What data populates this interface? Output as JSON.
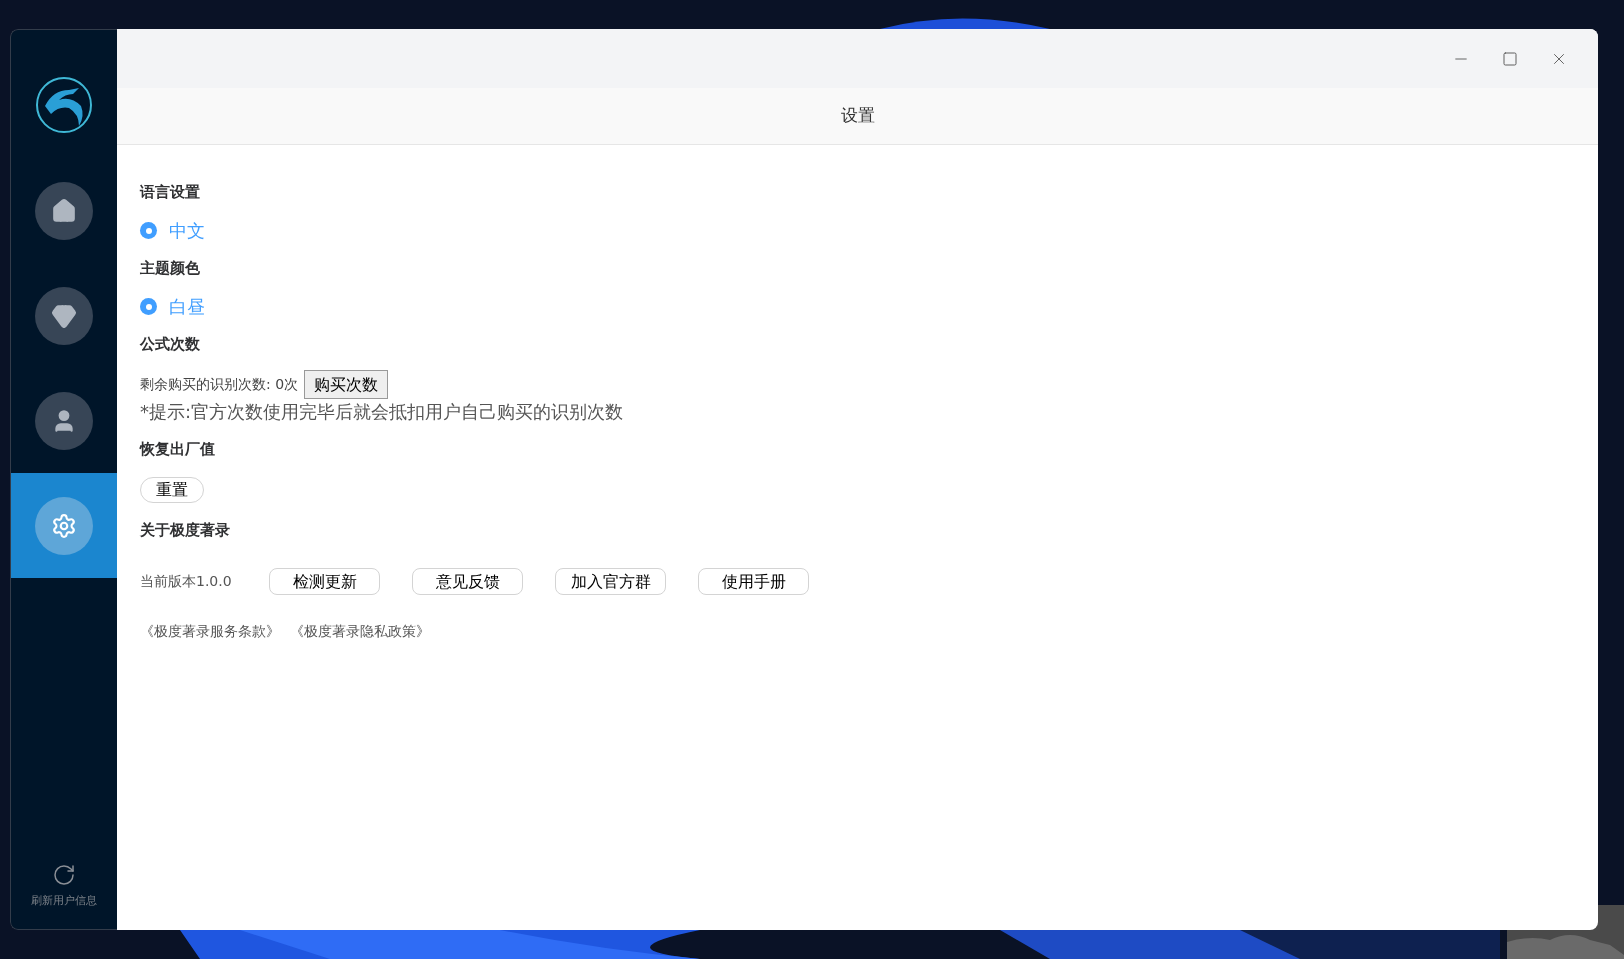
{
  "window": {
    "title": "设置"
  },
  "sidebar": {
    "items": [
      {
        "kind": "home",
        "selected": false
      },
      {
        "kind": "diamond",
        "selected": false
      },
      {
        "kind": "user",
        "selected": false
      },
      {
        "kind": "settings",
        "selected": true
      }
    ],
    "footer": {
      "label": "刷新用户信息"
    }
  },
  "sections": [
    {
      "kind": "radio",
      "title": "语言设置",
      "options": [
        {
          "label": "中文",
          "selected": true
        }
      ]
    },
    {
      "kind": "radio",
      "title": "主题颜色",
      "options": [
        {
          "label": "白昼",
          "selected": true
        }
      ]
    },
    {
      "kind": "credits",
      "title": "公式次数",
      "remaining": "剩余购买的识别次数: 0次",
      "button": "购买次数",
      "hint": "*提示:官方次数使用完毕后就会抵扣用户自己购买的识别次数"
    },
    {
      "kind": "reset",
      "title": "恢复出厂值",
      "button": "重置"
    },
    {
      "kind": "about",
      "title": "关于极度著录",
      "version": "当前版本1.0.0",
      "buttons": [
        "检测更新",
        "意见反馈",
        "加入官方群",
        "使用手册"
      ],
      "links": [
        "《极度著录服务条款》",
        "《极度著录隐私政策》"
      ]
    }
  ]
}
